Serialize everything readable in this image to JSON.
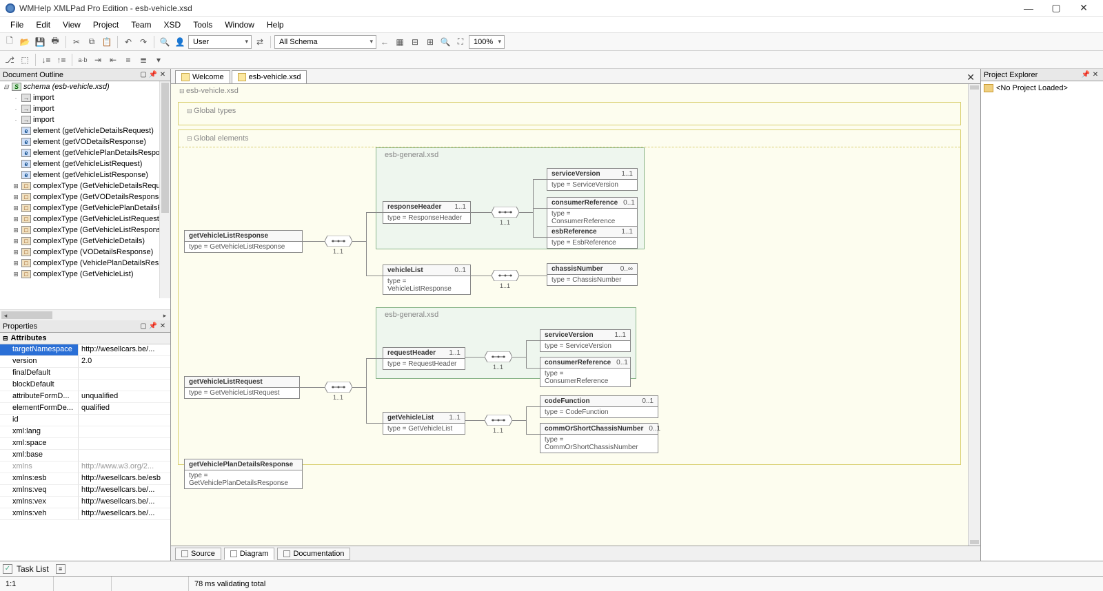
{
  "app": {
    "title": "WMHelp XMLPad Pro Edition - esb-vehicle.xsd"
  },
  "menu": [
    "File",
    "Edit",
    "View",
    "Project",
    "Team",
    "XSD",
    "Tools",
    "Window",
    "Help"
  ],
  "toolbar1": {
    "combo_user": "User",
    "combo_schema": "All Schema",
    "zoom": "100%"
  },
  "panels": {
    "outline": "Document Outline",
    "properties": "Properties",
    "projexp": "Project Explorer"
  },
  "outline": {
    "root": "schema (esb-vehicle.xsd)",
    "items": [
      {
        "exp": "·",
        "ico": "imp",
        "label": "import"
      },
      {
        "exp": "·",
        "ico": "imp",
        "label": "import"
      },
      {
        "exp": "·",
        "ico": "imp",
        "label": "import"
      },
      {
        "exp": "",
        "ico": "e",
        "label": "element (getVehicleDetailsRequest)"
      },
      {
        "exp": "",
        "ico": "e",
        "label": "element (getVODetailsResponse)"
      },
      {
        "exp": "",
        "ico": "e",
        "label": "element (getVehiclePlanDetailsRespons"
      },
      {
        "exp": "",
        "ico": "e",
        "label": "element (getVehicleListRequest)"
      },
      {
        "exp": "",
        "ico": "e",
        "label": "element (getVehicleListResponse)"
      },
      {
        "exp": "⊞",
        "ico": "c",
        "label": "complexType (GetVehicleDetailsReques"
      },
      {
        "exp": "⊞",
        "ico": "c",
        "label": "complexType (GetVODetailsResponse)"
      },
      {
        "exp": "⊞",
        "ico": "c",
        "label": "complexType (GetVehiclePlanDetailsRe"
      },
      {
        "exp": "⊞",
        "ico": "c",
        "label": "complexType (GetVehicleListRequest)"
      },
      {
        "exp": "⊞",
        "ico": "c",
        "label": "complexType (GetVehicleListResponse)"
      },
      {
        "exp": "⊞",
        "ico": "c",
        "label": "complexType (GetVehicleDetails)"
      },
      {
        "exp": "⊞",
        "ico": "c",
        "label": "complexType (VODetailsResponse)"
      },
      {
        "exp": "⊞",
        "ico": "c",
        "label": "complexType (VehiclePlanDetailsRespo"
      },
      {
        "exp": "⊞",
        "ico": "c",
        "label": "complexType (GetVehicleList)"
      }
    ]
  },
  "properties": {
    "section": "Attributes",
    "rows": [
      {
        "name": "targetNamespace",
        "value": "http://wesellcars.be/...",
        "sel": true
      },
      {
        "name": "version",
        "value": "2.0"
      },
      {
        "name": "finalDefault",
        "value": ""
      },
      {
        "name": "blockDefault",
        "value": ""
      },
      {
        "name": "attributeFormD...",
        "value": "unqualified"
      },
      {
        "name": "elementFormDe...",
        "value": "qualified"
      },
      {
        "name": "id",
        "value": ""
      },
      {
        "name": "xml:lang",
        "value": ""
      },
      {
        "name": "xml:space",
        "value": ""
      },
      {
        "name": "xml:base",
        "value": ""
      },
      {
        "name": "xmlns",
        "value": "http://www.w3.org/2...",
        "dim": true
      },
      {
        "name": "xmlns:esb",
        "value": "http://wesellcars.be/esb"
      },
      {
        "name": "xmlns:veq",
        "value": "http://wesellcars.be/..."
      },
      {
        "name": "xmlns:vex",
        "value": "http://wesellcars.be/..."
      },
      {
        "name": "xmlns:veh",
        "value": "http://wesellcars.be/..."
      }
    ]
  },
  "tabs": {
    "doc": [
      "Welcome",
      "esb-vehicle.xsd"
    ],
    "view": [
      "Source",
      "Diagram",
      "Documentation"
    ]
  },
  "diagram": {
    "file": "esb-vehicle.xsd",
    "section_types": "Global types",
    "section_elems": "Global elements",
    "grp1": "esb-general.xsd",
    "grp2": "esb-general.xsd",
    "nodes": {
      "n1": {
        "name": "getVehicleListResponse",
        "type": "type = GetVehicleListResponse",
        "card": ""
      },
      "n2": {
        "name": "responseHeader",
        "type": "type = ResponseHeader",
        "card": "1..1"
      },
      "n3": {
        "name": "vehicleList",
        "type": "type = VehicleListResponse",
        "card": "0..1"
      },
      "n4": {
        "name": "serviceVersion",
        "type": "type = ServiceVersion",
        "card": "1..1"
      },
      "n5": {
        "name": "consumerReference",
        "type": "type = ConsumerReference",
        "card": "0..1"
      },
      "n6": {
        "name": "esbReference",
        "type": "type = EsbReference",
        "card": "1..1"
      },
      "n7": {
        "name": "chassisNumber",
        "type": "type = ChassisNumber",
        "card": "0..∞"
      },
      "n8": {
        "name": "getVehicleListRequest",
        "type": "type = GetVehicleListRequest",
        "card": ""
      },
      "n9": {
        "name": "requestHeader",
        "type": "type = RequestHeader",
        "card": "1..1"
      },
      "n10": {
        "name": "getVehicleList",
        "type": "type = GetVehicleList",
        "card": "1..1"
      },
      "n11": {
        "name": "serviceVersion",
        "type": "type = ServiceVersion",
        "card": "1..1"
      },
      "n12": {
        "name": "consumerReference",
        "type": "type = ConsumerReference",
        "card": "0..1"
      },
      "n13": {
        "name": "codeFunction",
        "type": "type = CodeFunction",
        "card": "0..1"
      },
      "n14": {
        "name": "commOrShortChassisNumber",
        "type": "type = CommOrShortChassisNumber",
        "card": "0..1"
      },
      "n15": {
        "name": "getVehiclePlanDetailsResponse",
        "type": "type = GetVehiclePlanDetailsResponse",
        "card": ""
      }
    },
    "seq_card": "1..1"
  },
  "project": {
    "none": "<No Project Loaded>"
  },
  "bottom": {
    "tasks": "Task List",
    "pos": "1:1",
    "status": "78 ms validating total"
  }
}
